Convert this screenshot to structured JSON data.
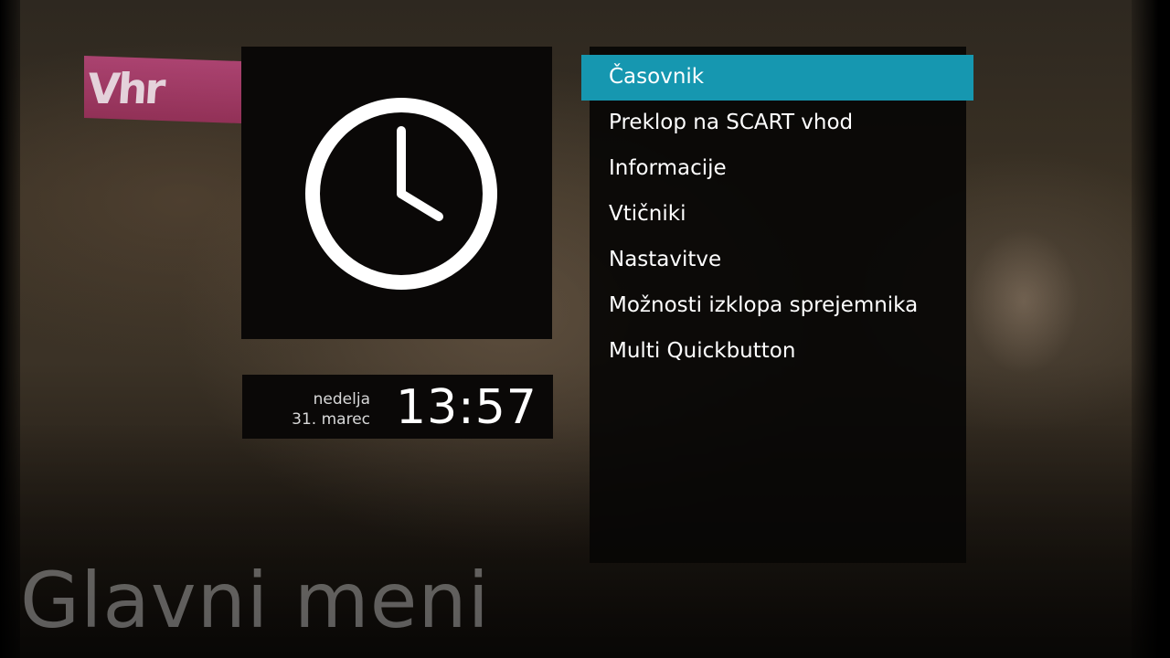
{
  "channel_logo": {
    "text": "Vhr",
    "color": "#b03c6e"
  },
  "clock_icon": {
    "icon": "clock-icon"
  },
  "datetime": {
    "weekday": "nedelja",
    "date": "31. marec",
    "time": "13:57"
  },
  "menu": {
    "selected_index": 0,
    "highlight_color": "#1697b0",
    "items": [
      {
        "label": "Časovnik"
      },
      {
        "label": "Preklop na SCART vhod"
      },
      {
        "label": "Informacije"
      },
      {
        "label": "Vtičniki"
      },
      {
        "label": "Nastavitve"
      },
      {
        "label": "Možnosti izklopa sprejemnika"
      },
      {
        "label": "Multi Quickbutton"
      }
    ]
  },
  "page": {
    "title": "Glavni meni"
  }
}
